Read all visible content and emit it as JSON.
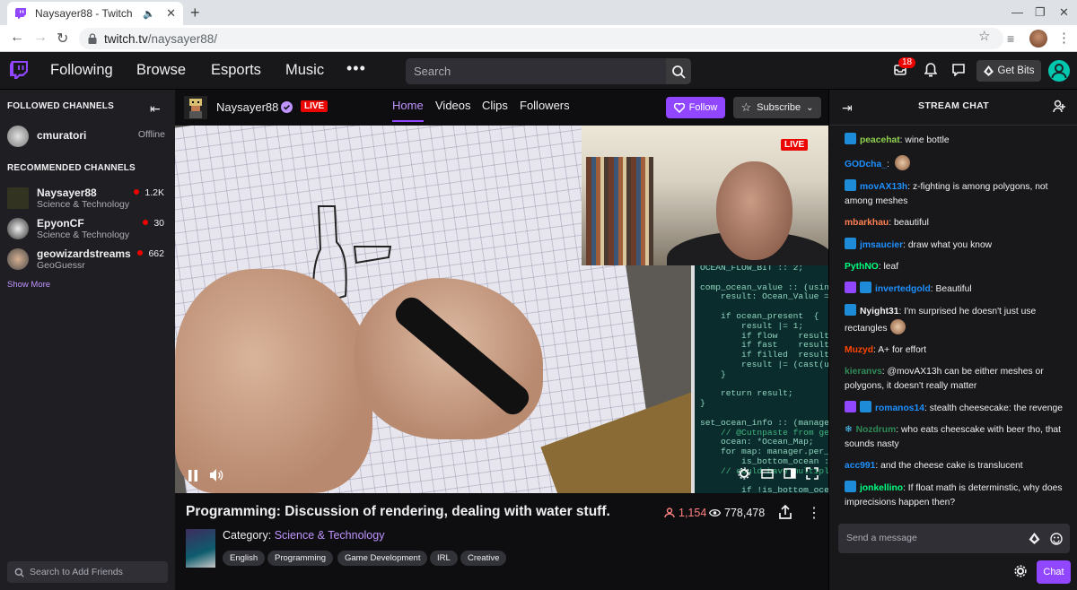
{
  "browser": {
    "tab_title": "Naysayer88 - Twitch",
    "url_domain": "twitch.tv",
    "url_path": "/naysayer88/"
  },
  "topnav": {
    "items": [
      "Following",
      "Browse",
      "Esports",
      "Music"
    ],
    "search_placeholder": "Search",
    "inbox_count": "18",
    "get_bits": "Get Bits"
  },
  "sidebar": {
    "followed_heading": "FOLLOWED CHANNELS",
    "followed": [
      {
        "name": "cmuratori",
        "status": "Offline"
      }
    ],
    "recommended_heading": "RECOMMENDED CHANNELS",
    "recommended": [
      {
        "name": "Naysayer88",
        "category": "Science & Technology",
        "viewers": "1.2K"
      },
      {
        "name": "EpyonCF",
        "category": "Science & Technology",
        "viewers": "30"
      },
      {
        "name": "geowizardstreams",
        "category": "GeoGuessr",
        "viewers": "662"
      }
    ],
    "show_more": "Show More",
    "search_friends": "Search to Add Friends"
  },
  "channel": {
    "name": "Naysayer88",
    "live": "LIVE",
    "tabs": [
      "Home",
      "Videos",
      "Clips",
      "Followers"
    ],
    "follow": "Follow",
    "subscribe": "Subscribe"
  },
  "video": {
    "live": "LIVE",
    "code_lines": [
      "OCEAN_FLOW_BIT :: 2;",
      "",
      "comp_ocean_value :: (using in",
      "    result: Ocean_Value = 0;",
      "",
      "    if ocean_present  {",
      "        result |= 1;",
      "        if flow    result |=",
      "        if fast    result |=",
      "        if filled  result |=",
      "        result |= (cast(u8)d",
      "    }",
      "",
      "    return result;",
      "}",
      "",
      "set_ocean_info :: (manager:",
      "    // @Cutnpaste from get_o",
      "    ocean: *Ocean_Map;",
      "    for map: manager.per_fram",
      "        is_bottom_ocean := (",
      "    // could have multiple Oceans",
      "",
      "        if !is_bottom_ocean"
    ]
  },
  "stream": {
    "title": "Programming: Discussion of rendering, dealing with water stuff.",
    "viewers": "1,154",
    "views": "778,478",
    "category_label": "Category:",
    "category": "Science & Technology",
    "tags": [
      "English",
      "Programming",
      "Game Development",
      "IRL",
      "Creative"
    ]
  },
  "chat": {
    "header": "STREAM CHAT",
    "messages": [
      {
        "user": "peacehat",
        "text": "wine bottle",
        "color": "#8fd14f"
      },
      {
        "user": "GODcha_",
        "text": "",
        "color": "#1e90ff"
      },
      {
        "user": "movAX13h",
        "text": "z-fighting is among polygons, not among meshes",
        "color": "#1e90ff"
      },
      {
        "user": "mbarkhau",
        "text": "beautiful",
        "color": "#ff7f50"
      },
      {
        "user": "jmsaucier",
        "text": "draw what you know",
        "color": "#1e90ff"
      },
      {
        "user": "PythNO",
        "text": "leaf",
        "color": "#00ff7f"
      },
      {
        "user": "invertedgold",
        "text": "Beautiful",
        "color": "#1e90ff"
      },
      {
        "user": "Nyight31",
        "text": "I'm surprised he doesn't just use rectangles",
        "color": "#efeff1"
      },
      {
        "user": "Muzyd",
        "text": "A+ for effort",
        "color": "#ff4500"
      },
      {
        "user": "kieranvs",
        "text": "@movAX13h can be either meshes or polygons, it doesn't really matter",
        "color": "#2e8b57"
      },
      {
        "user": "romanos14",
        "text": "stealth cheesecake: the revenge",
        "color": "#1e90ff"
      },
      {
        "user": "Nozdrum",
        "text": "who eats cheescake with beer tho, that sounds nasty",
        "color": "#2e8b57"
      },
      {
        "user": "acc991",
        "text": "and the cheese cake is translucent",
        "color": "#1e90ff"
      },
      {
        "user": "jonkellino",
        "text": "If float math is determinstic, why does imprecisions happen then?",
        "color": "#00ff7f"
      }
    ],
    "input_placeholder": "Send a message",
    "chat_button": "Chat"
  }
}
